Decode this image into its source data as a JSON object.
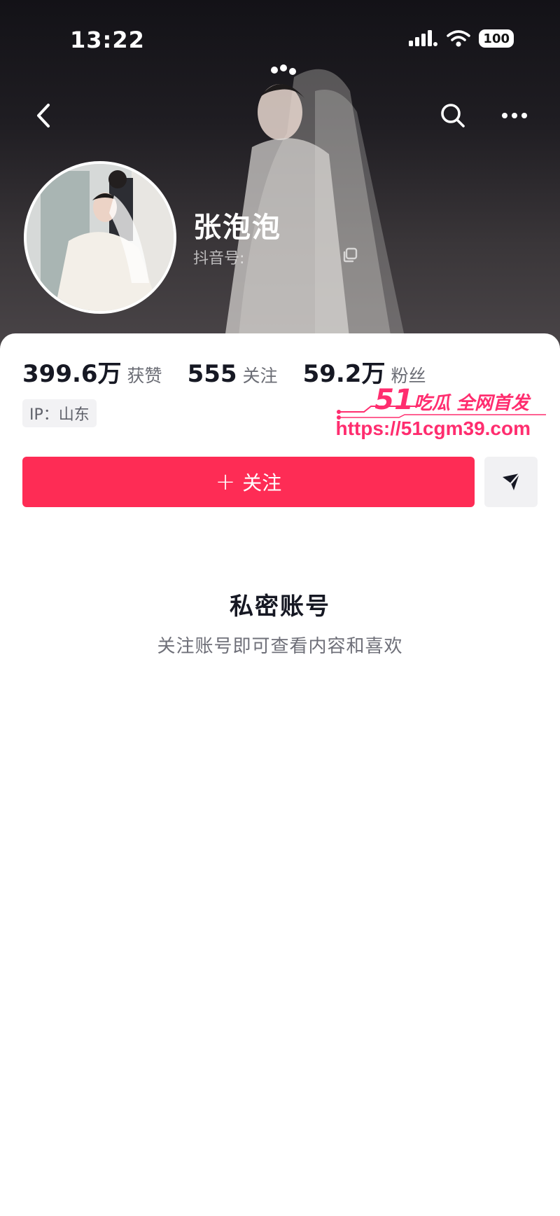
{
  "status_bar": {
    "time": "13:22",
    "battery": "100",
    "icons": [
      "signal-icon",
      "wifi-icon",
      "battery-icon"
    ]
  },
  "nav": {
    "icons": [
      "back-icon",
      "search-icon",
      "more-icon"
    ]
  },
  "profile": {
    "nickname": "张泡泡",
    "douyin_id_label": "抖音号:"
  },
  "stats": [
    {
      "value": "399.6万",
      "label": "获赞"
    },
    {
      "value": "555",
      "label": "关注"
    },
    {
      "value": "59.2万",
      "label": "粉丝"
    }
  ],
  "ip_tag": "IP：山东",
  "actions": {
    "follow_plus": "+",
    "follow_label": "关注",
    "share_icon": "send-icon"
  },
  "private_notice": {
    "title": "私密账号",
    "description": "关注账号即可查看内容和喜欢"
  },
  "watermark": {
    "number": "51",
    "title": "吃瓜 全网首发",
    "url": "https://51cgm39.com"
  },
  "colors": {
    "accent": "#fe2c55",
    "watermark": "#ff2d6f"
  }
}
